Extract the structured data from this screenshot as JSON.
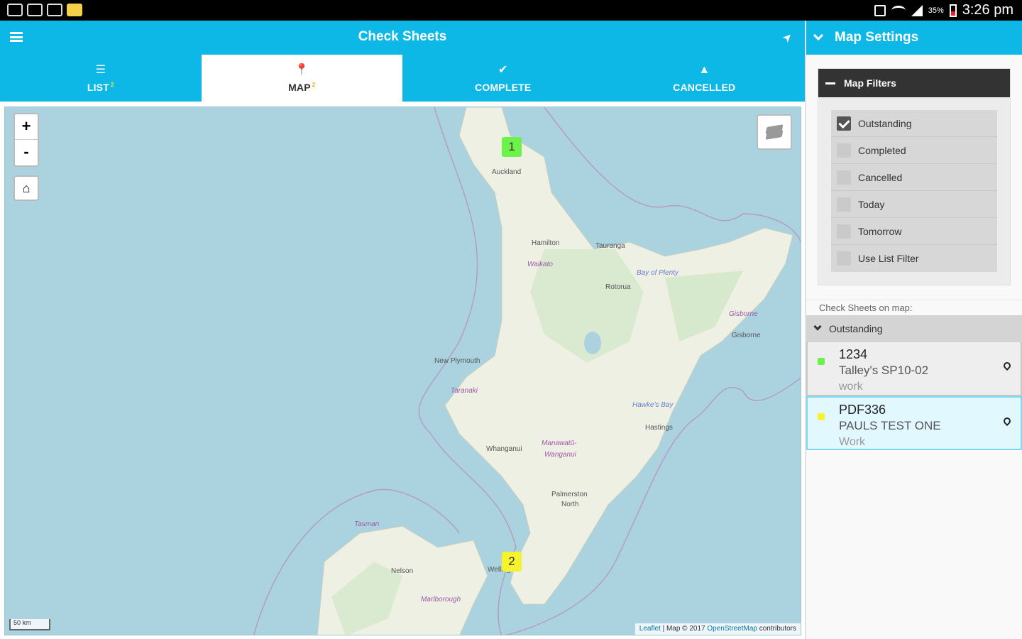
{
  "status_bar": {
    "time": "3:26 pm",
    "battery": "35%"
  },
  "app_bar": {
    "title": "Check Sheets"
  },
  "tabs": [
    {
      "label": "LIST",
      "badge": "2",
      "icon": "list-icon",
      "active": false
    },
    {
      "label": "MAP",
      "badge": "2",
      "icon": "map-pin-icon",
      "active": true
    },
    {
      "label": "COMPLETE",
      "badge": "",
      "icon": "check-icon",
      "active": false
    },
    {
      "label": "CANCELLED",
      "badge": "",
      "icon": "warning-icon",
      "active": false
    }
  ],
  "map": {
    "zoom_in": "+",
    "zoom_out": "-",
    "scale": "50 km",
    "attribution": {
      "leaflet": "Leaflet",
      "middle": " | Map © 2017 ",
      "osm": "OpenStreetMap",
      "end": " contributors"
    },
    "markers": [
      {
        "label": "1",
        "color": "#6df24a"
      },
      {
        "label": "2",
        "color": "#f6f22e"
      }
    ],
    "places": {
      "auckland": "Auckland",
      "hamilton": "Hamilton",
      "tauranga": "Tauranga",
      "waikato": "Waikato",
      "bay_of_plenty": "Bay of Plenty",
      "rotorua": "Rotorua",
      "gisborne_region": "Gisborne",
      "gisborne": "Gisborne",
      "new_plymouth": "New Plymouth",
      "taranaki": "Taranaki",
      "hawkes_bay": "Hawke's Bay",
      "hastings": "Hastings",
      "manawatu": "Manawatū-",
      "wanganui": "Wanganui",
      "whanganui": "Whanganui",
      "palmerston": "Palmerston",
      "north": "North",
      "tasman": "Tasman",
      "nelson": "Nelson",
      "wellington": "Wellington",
      "marlborough": "Marlborough"
    }
  },
  "panel": {
    "title": "Map Settings",
    "filters_title": "Map Filters",
    "filters": [
      {
        "label": "Outstanding",
        "checked": true
      },
      {
        "label": "Completed",
        "checked": false
      },
      {
        "label": "Cancelled",
        "checked": false
      },
      {
        "label": "Today",
        "checked": false
      },
      {
        "label": "Tomorrow",
        "checked": false
      },
      {
        "label": "Use List Filter",
        "checked": false
      }
    ],
    "on_map_label": "Check Sheets on map:",
    "group_label": "Outstanding",
    "sheets": [
      {
        "id": "1234",
        "name": "Talley's SP10-02",
        "type": "work",
        "color": "#6df24a",
        "selected": false
      },
      {
        "id": "PDF336",
        "name": "PAULS TEST ONE",
        "type": "Work",
        "color": "#f6f22e",
        "selected": true
      }
    ]
  }
}
